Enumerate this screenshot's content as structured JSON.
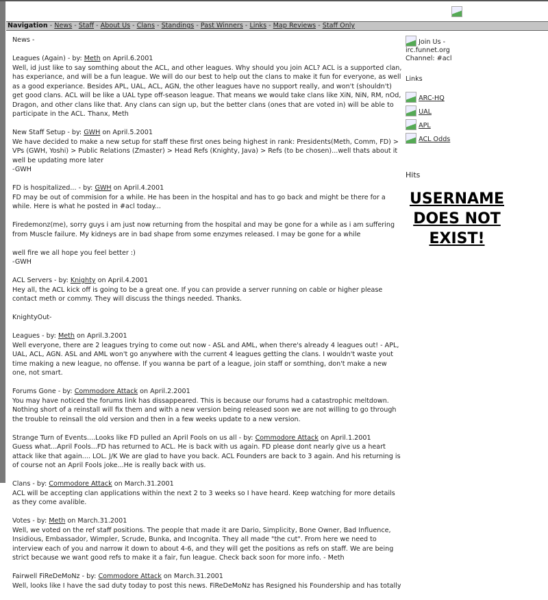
{
  "nav": {
    "label": "Navigation",
    "items": [
      "News",
      "Staff",
      "About Us",
      "Clans",
      "Standings",
      "Past Winners",
      "Links",
      "Map Reviews",
      "Staff Only"
    ]
  },
  "main": {
    "heading": "News -",
    "posts": [
      {
        "title": "Leagues (Again)",
        "author": "Meth",
        "date": "April.6.2001",
        "body": [
          "Well, id just like to say somthing about the ACL, and other leagues. Why should you join ACL? ACL is a supported clan, has experiance, and will be a fun league. We will do our best to help out the clans to make it fun for everyone, as well as a good experiance. Besides APL, UAL, ACL, AGN, the other leagues have no support really, and won't (shouldn't) get good clans. ACL will be like a UAL type off-season league. That means we would take clans like XiN, NiN, RM, nOd, Dragon, and other clans like that. Any clans can sign up, but the better clans (ones that are voted in) will be able to participate in the ACL. Thanx, Meth"
        ]
      },
      {
        "title": "New Staff Setup",
        "author": "GWH",
        "date": "April.5.2001",
        "body": [
          "We have decided to make a new setup for staff these first ones being highest in rank: Presidents(Meth, Comm, FD) > VPs (GWH, Yoshi) > Public Relations (Zmaster) > Head Refs (Knighty, Java) > Refs (to be chosen)...well thats about it well be updating more later\n-GWH"
        ]
      },
      {
        "title": "FD is hospitalized...",
        "author": "GWH",
        "date": "April.4.2001",
        "body": [
          "FD may be out of commision for a while. He has been in the hospital and has to go back and might be there for a while. Here is what he posted in #acl today...",
          "Firedemonz(me), sorry guys i am just now returning from the hospital and may be gone for a while as i am suffering from Muscle failure. My kidneys are in bad shape from some enzymes released. I may be gone for a while",
          "well fire we all hope you feel better :)\n-GWH"
        ]
      },
      {
        "title": "ACL Servers",
        "author": "Knighty",
        "date": "April.4.2001",
        "body": [
          "Hey all, the ACL kick off is going to be a great one. If you can provide a server running on cable or higher please contact meth or commy. They will discuss the things needed. Thanks.",
          "KnightyOut-"
        ]
      },
      {
        "title": "Leagues",
        "author": "Meth",
        "date": "April.3.2001",
        "body": [
          "Well everyone, there are 2 leagues trying to come out now - ASL and AML, when there's already 4 leagues out! - APL, UAL, ACL, AGN. ASL and AML won't go anywhere with the current 4 leagues getting the clans. I wouldn't waste yout time making a new league, no offense. If you wanna be part of a league, join staff or somthing, don't make a new one, not smart."
        ]
      },
      {
        "title": "Forums Gone",
        "author": "Commodore Attack",
        "date": "April.2.2001",
        "body": [
          "You may have noticed the forums link has dissappeared. This is because our forums had a catastrophic meltdown. Nothing short of a reinstall will fix them and with a new version being released soon we are not willing to go through the trouble to reinsall the old version and then in a few weeks update to a new version."
        ]
      },
      {
        "title": "Strange Turn of Events....Looks like FD pulled an April Fools on us all",
        "author": "Commodore Attack",
        "date": "April.1.2001",
        "body": [
          "Guess what...April Fools...FD has returned to ACL. He is back with us again. FD please dont nearly give us a heart attack like that again.... LOL. J/K We are glad to have you back. ACL Founders are back to 3 again. And his returning is of course not an April Fools joke...He is really back with us."
        ]
      },
      {
        "title": "Clans",
        "author": "Commodore Attack",
        "date": "March.31.2001",
        "body": [
          "ACL will be accepting clan applications within the next 2 to 3 weeks so I have heard. Keep watching for more details as they come avalible."
        ]
      },
      {
        "title": "Votes",
        "author": "Meth",
        "date": "March.31.2001",
        "body": [
          "Well, we voted on the ref staff positions. The people that made it are Dario, Simplicity, Bone Owner, Bad Influence, Insidious, Embassador, Wimpler, Scrude, Bunka, and Incognita. They all made \"the cut\". From here we need to interview each of you and narrow it down to about 4-6, and they will get the positions as refs on staff. We are being strict because we want good refs to make it a fair, fun league. Check back soon for more info. - Meth"
        ]
      },
      {
        "title": "Fairwell FiReDeMoNz",
        "author": "Commodore Attack",
        "date": "March.31.2001",
        "body": [
          "Well, looks like I have the sad duty today to post this news. FiReDeMoNz has Resigned his Foundership and has totally"
        ]
      }
    ],
    "by_label": " - by: ",
    "on_label": " on "
  },
  "side": {
    "join": [
      "Join Us -",
      "irc.funnet.org",
      "Channel: #acl"
    ],
    "links_title": "Links",
    "links": [
      "ARC-HQ",
      "UAL",
      "APL",
      "ACL Odds"
    ],
    "hits_title": "Hits",
    "hits_error": "USERNAME DOES NOT EXIST!"
  }
}
